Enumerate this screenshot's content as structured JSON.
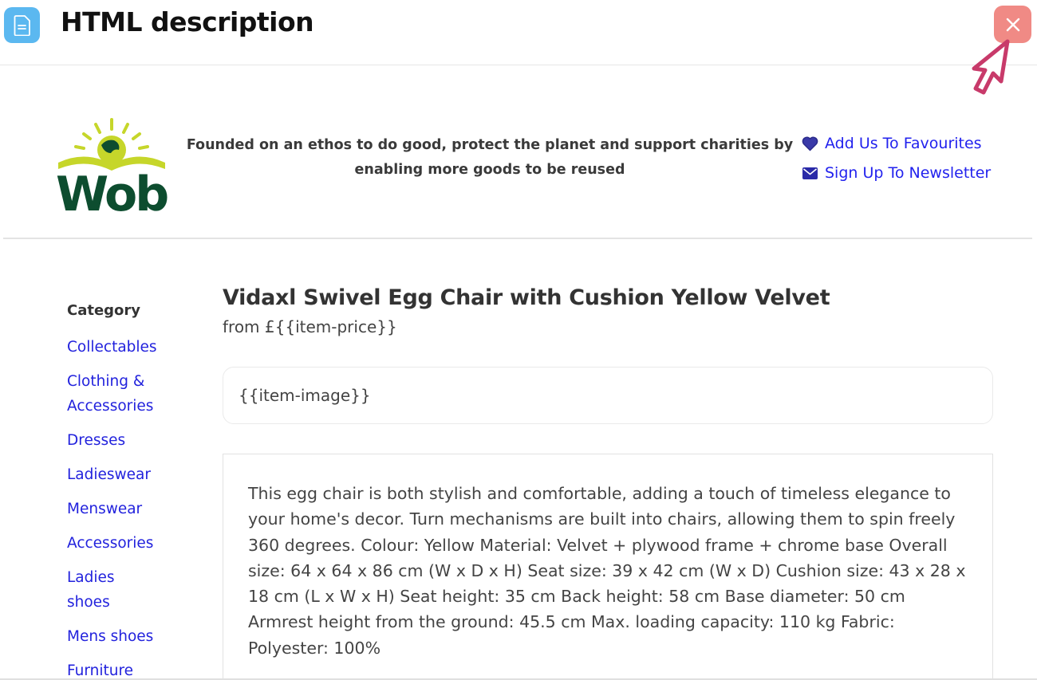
{
  "modal": {
    "title": "HTML description",
    "close_label": "×"
  },
  "site": {
    "logo_text": "Wob",
    "tagline": "Founded on an ethos to do good, protect the planet and support charities by enabling more goods to be reused",
    "favourites_label": "Add Us To Favourites",
    "newsletter_label": "Sign Up To Newsletter"
  },
  "sidebar": {
    "heading": "Category",
    "items": [
      {
        "label": "Collectables"
      },
      {
        "label": "Clothing & Accessories"
      },
      {
        "label": "Dresses"
      },
      {
        "label": "Ladieswear"
      },
      {
        "label": "Menswear"
      },
      {
        "label": "Accessories"
      },
      {
        "label": "Ladies shoes"
      },
      {
        "label": "Mens shoes"
      },
      {
        "label": "Furniture"
      }
    ]
  },
  "product": {
    "title": "Vidaxl Swivel Egg Chair with Cushion Yellow Velvet",
    "price": "from £{{item-price}}",
    "image_placeholder": "{{item-image}}",
    "description": "This egg chair is both stylish and comfortable, adding a touch of timeless elegance to your home's decor. Turn mechanisms are built into chairs, allowing them to spin freely 360 degrees. Colour: Yellow Material: Velvet + plywood frame + chrome base Overall size: 64 x 64 x 86 cm (W x D x H) Seat size: 39 x 42 cm (W x D) Cushion size: 43 x 28 x 18 cm (L x W x H) Seat height: 35 cm Back height: 58 cm Base diameter: 50 cm Armrest height from the ground: 45.5 cm Max. loading capacity: 110 kg Fabric: Polyester: 100%"
  },
  "colors": {
    "link": "#2222ee",
    "doc_icon_bg": "#5bb8f0",
    "close_bg": "#f08a85",
    "cursor": "#c83a6a",
    "logo_green": "#0d4d2f",
    "logo_yellow": "#c6d62a"
  }
}
